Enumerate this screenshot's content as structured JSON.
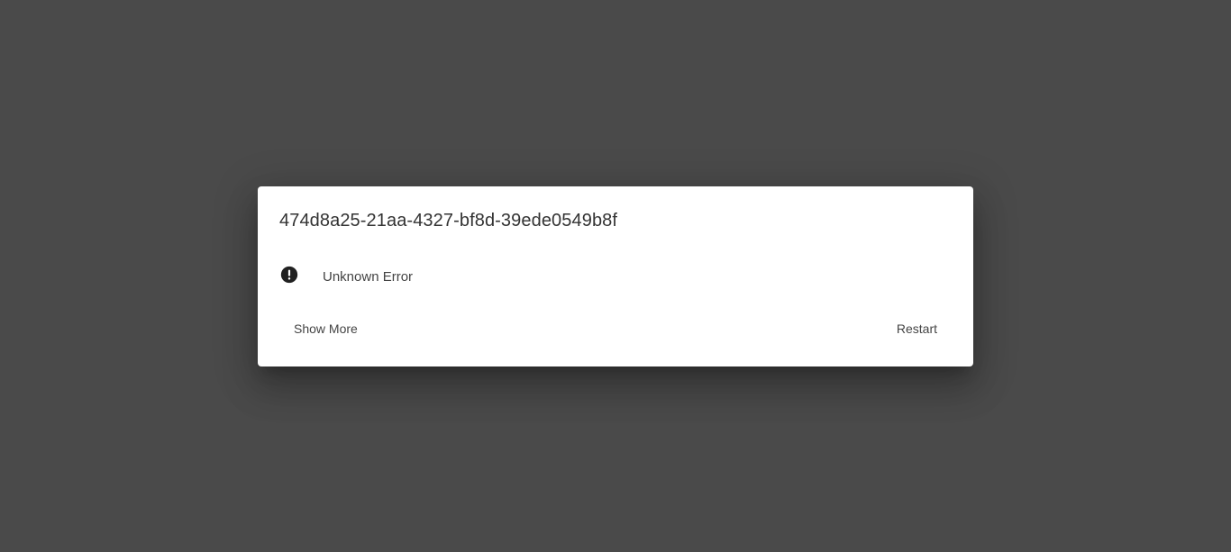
{
  "dialog": {
    "title": "474d8a25-21aa-4327-bf8d-39ede0549b8f",
    "error_icon": "exclamation-circle-icon",
    "error_message": "Unknown Error",
    "show_more_label": "Show More",
    "restart_label": "Restart"
  },
  "colors": {
    "backdrop": "#4a4a4a",
    "dialog_background": "#ffffff",
    "text": "#333333",
    "icon": "#212121"
  }
}
